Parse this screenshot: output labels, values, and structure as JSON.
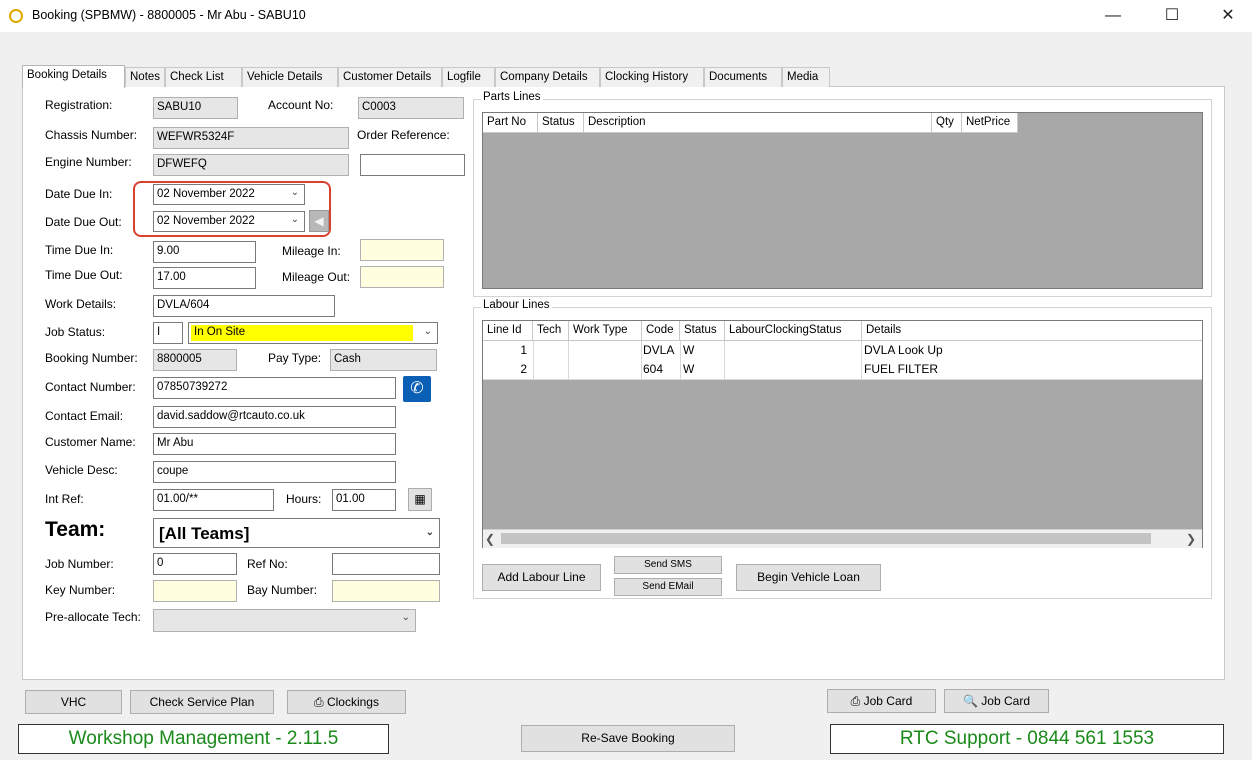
{
  "window": {
    "title": "Booking (SPBMW) - 8800005 - Mr Abu - SABU10",
    "minimize": "—",
    "maximize": "☐",
    "close": "✕"
  },
  "tabs": [
    "Booking Details",
    "Notes",
    "Check List",
    "Vehicle Details",
    "Customer Details",
    "Logfile",
    "Company Details",
    "Clocking History",
    "Documents",
    "Media"
  ],
  "form": {
    "registration_label": "Registration:",
    "registration": "SABU10",
    "account_label": "Account No:",
    "account": "C0003",
    "chassis_label": "Chassis Number:",
    "chassis": "WEFWR5324F",
    "order_ref_label": "Order Reference:",
    "order_ref": "",
    "engine_label": "Engine Number:",
    "engine": "DFWEFQ",
    "date_in_label": "Date Due In:",
    "date_in": "02 November 2022",
    "date_out_label": "Date Due Out:",
    "date_out": "02 November 2022",
    "time_in_label": "Time Due In:",
    "time_in": "9.00",
    "mileage_in_label": "Mileage In:",
    "mileage_in": "",
    "time_out_label": "Time Due Out:",
    "time_out": "17.00",
    "mileage_out_label": "Mileage Out:",
    "mileage_out": "",
    "work_details_label": "Work Details:",
    "work_details": "DVLA/604",
    "job_status_label": "Job Status:",
    "job_status_code": "I",
    "job_status": "In On Site",
    "booking_number_label": "Booking Number:",
    "booking_number": "8800005",
    "pay_type_label": "Pay Type:",
    "pay_type": "Cash",
    "contact_number_label": "Contact Number:",
    "contact_number": "07850739272",
    "contact_email_label": "Contact Email:",
    "contact_email": "david.saddow@rtcauto.co.uk",
    "customer_name_label": "Customer Name:",
    "customer_name": "Mr Abu",
    "vehicle_desc_label": "Vehicle Desc:",
    "vehicle_desc": "coupe",
    "int_ref_label": "Int Ref:",
    "int_ref": "01.00/**",
    "hours_label": "Hours:",
    "hours": "01.00",
    "team_label": "Team:",
    "team": "[All Teams]",
    "job_number_label": "Job Number:",
    "job_number": "0",
    "ref_no_label": "Ref No:",
    "ref_no": "",
    "key_number_label": "Key Number:",
    "key_number": "",
    "bay_number_label": "Bay Number:",
    "bay_number": "",
    "preallocate_label": "Pre-allocate Tech:",
    "preallocate": ""
  },
  "parts": {
    "title": "Parts Lines",
    "columns": [
      "Part No",
      "Status",
      "Description",
      "Qty",
      "NetPrice"
    ]
  },
  "labour": {
    "title": "Labour Lines",
    "columns": [
      "Line Id",
      "Tech",
      "Work Type",
      "Code",
      "Status",
      "LabourClockingStatus",
      "Details"
    ],
    "rows": [
      {
        "id": "1",
        "tech": "",
        "work_type": "",
        "code": "DVLA",
        "status": "W",
        "clocking": "",
        "details": "DVLA Look Up"
      },
      {
        "id": "2",
        "tech": "",
        "work_type": "",
        "code": "604",
        "status": "W",
        "clocking": "",
        "details": "FUEL FILTER"
      }
    ],
    "add_button": "Add Labour Line",
    "send_sms": "Send SMS",
    "send_email": "Send EMail",
    "vehicle_loan": "Begin Vehicle Loan"
  },
  "bottom": {
    "vhc": "VHC",
    "check_service_plan": "Check Service Plan",
    "clockings": "Clockings",
    "job_card_print": "Job Card",
    "job_card_preview": "Job Card",
    "resave": "Re-Save Booking",
    "version_banner": "Workshop Management - 2.11.5",
    "support_banner": "RTC Support - 0844 561 1553"
  },
  "colors": {
    "job_status_highlight": "#ffff00",
    "banner_text": "#1a8a1a",
    "annotation": "#d9402e",
    "phone_button": "#0b5fb5"
  }
}
